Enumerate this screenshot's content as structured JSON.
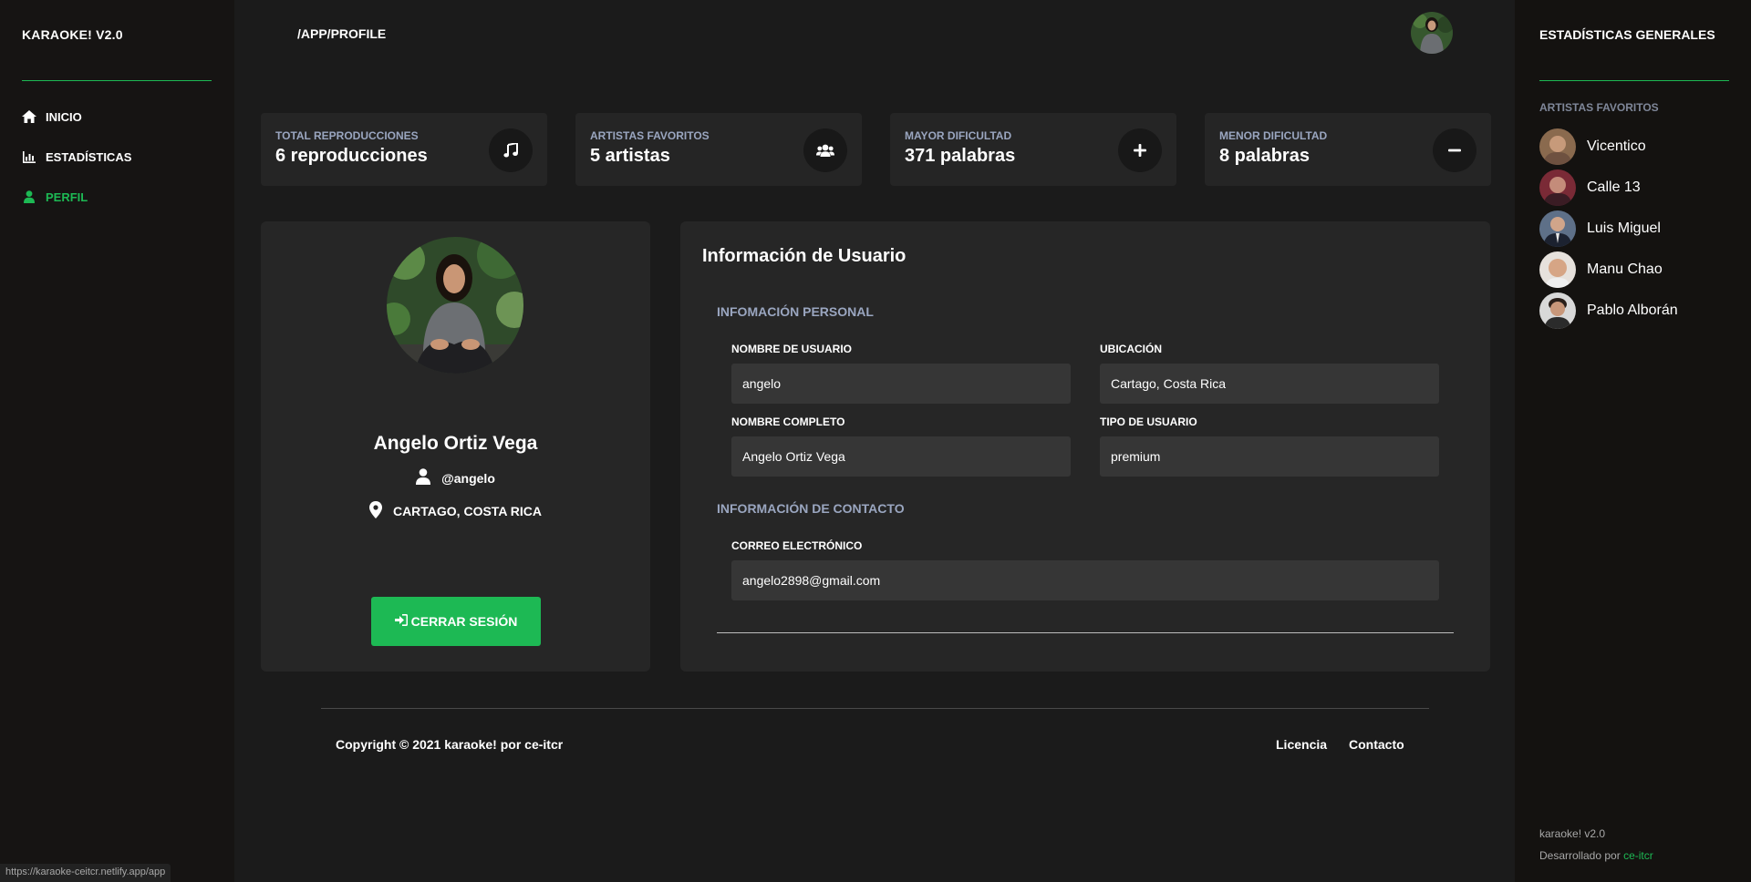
{
  "brand": "KARAOKE! V2.0",
  "nav": [
    {
      "label": "INICIO",
      "icon": "home-icon",
      "active": false
    },
    {
      "label": "ESTADÍSTICAS",
      "icon": "bar-chart-icon",
      "active": false
    },
    {
      "label": "PERFIL",
      "icon": "user-icon",
      "active": true
    }
  ],
  "status_url": "https://karaoke-ceitcr.netlify.app/app",
  "header": {
    "breadcrumb": "/APP/PROFILE"
  },
  "stats": [
    {
      "label": "TOTAL REPRODUCCIONES",
      "value": "6 reproducciones",
      "icon": "music-note-icon"
    },
    {
      "label": "ARTISTAS FAVORITOS",
      "value": "5 artistas",
      "icon": "users-icon"
    },
    {
      "label": "MAYOR DIFICULTAD",
      "value": "371 palabras",
      "icon": "plus-icon"
    },
    {
      "label": "MENOR DIFICULTAD",
      "value": "8 palabras",
      "icon": "minus-icon"
    }
  ],
  "profile": {
    "name": "Angelo Ortiz Vega",
    "username": "@angelo",
    "location": "CARTAGO, COSTA RICA",
    "logout_label": "CERRAR SESIÓN"
  },
  "info": {
    "title": "Información de Usuario",
    "personal_section": "INFOMACIÓN PERSONAL",
    "contact_section": "INFORMACIÓN DE CONTACTO",
    "fields": {
      "username": {
        "label": "NOMBRE DE USUARIO",
        "value": "angelo"
      },
      "location": {
        "label": "UBICACIÓN",
        "value": "Cartago, Costa Rica"
      },
      "fullname": {
        "label": "NOMBRE COMPLETO",
        "value": "Angelo Ortiz Vega"
      },
      "usertype": {
        "label": "TIPO DE USUARIO",
        "value": "premium"
      },
      "email": {
        "label": "CORREO ELECTRÓNICO",
        "value": "angelo2898@gmail.com"
      }
    }
  },
  "footer": {
    "copyright": "Copyright © 2021 karaoke! por ce-itcr",
    "links": [
      "Licencia",
      "Contacto"
    ]
  },
  "right": {
    "title": "ESTADÍSTICAS GENERALES",
    "subtitle": "ARTISTAS FAVORITOS",
    "artists": [
      "Vicentico",
      "Calle 13",
      "Luis Miguel",
      "Manu Chao",
      "Pablo Alborán"
    ],
    "version": "karaoke! v2.0",
    "developed_by": "Desarrollado por",
    "developer_link": "ce-itcr"
  },
  "colors": {
    "accent": "#1db954",
    "muted_label": "#9aa6c0"
  }
}
